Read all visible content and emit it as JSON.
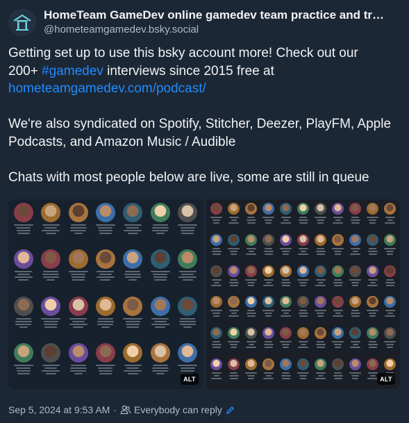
{
  "author": {
    "display_name": "HomeTeam GameDev online gamedev team practice and tr…",
    "handle": "@hometeamgamedev.bsky.social",
    "avatar_icon": "house-logo-icon"
  },
  "post": {
    "line1_a": "Getting set up to use this bsky account more! Check out our",
    "line2_a": "200+ ",
    "hashtag": "#gamedev",
    "line2_b": " interviews since 2015 free at",
    "link": "hometeamgamedev.com/podcast/",
    "paragraph2": "We're also syndicated on Spotify, Stitcher, Deezer, PlayFM, Apple Podcasts, and Amazon Music / Audible",
    "paragraph3": "Chats with most people below are live, some are still in queue"
  },
  "media": {
    "image1_alt_badge": "ALT",
    "image2_alt_badge": "ALT",
    "image1_description": "grid-of-guest-portraits",
    "image2_description": "grid-of-guest-portraits"
  },
  "footer": {
    "timestamp": "Sep 5, 2024 at 9:53 AM",
    "separator": "·",
    "reply_setting": "Everybody can reply",
    "people_icon": "people-icon",
    "edit_icon": "pencil-icon"
  },
  "colors": {
    "background": "#1c2735",
    "link": "#208bfe",
    "muted": "#aebbc9",
    "text": "#f1f3f5"
  }
}
